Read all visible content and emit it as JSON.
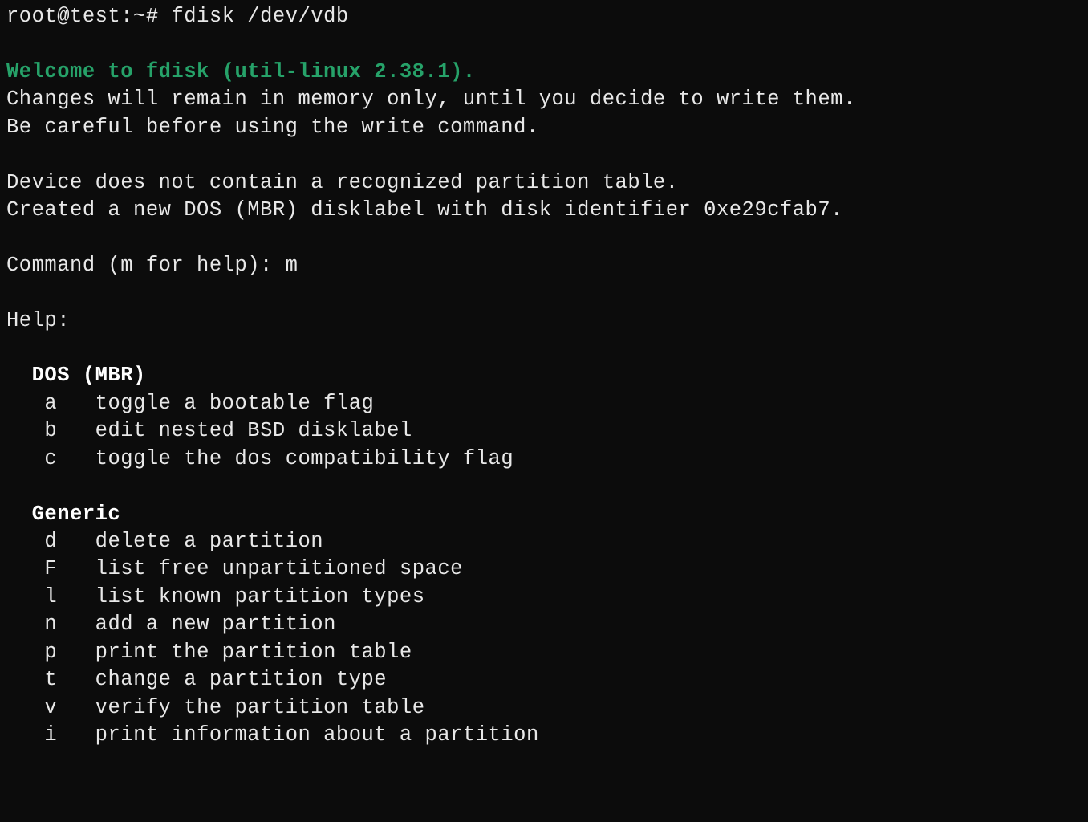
{
  "prompt": {
    "user_host": "root@test",
    "path": "~",
    "symbol": "#",
    "command": "fdisk /dev/vdb"
  },
  "welcome": "Welcome to fdisk (util-linux 2.38.1).",
  "warning_line1": "Changes will remain in memory only, until you decide to write them.",
  "warning_line2": "Be careful before using the write command.",
  "device_line1": "Device does not contain a recognized partition table.",
  "device_line2": "Created a new DOS (MBR) disklabel with disk identifier 0xe29cfab7.",
  "command_prompt": "Command (m for help): ",
  "command_input": "m",
  "help_header": "Help:",
  "sections": [
    {
      "title": "DOS (MBR)",
      "items": [
        {
          "key": "a",
          "desc": "toggle a bootable flag"
        },
        {
          "key": "b",
          "desc": "edit nested BSD disklabel"
        },
        {
          "key": "c",
          "desc": "toggle the dos compatibility flag"
        }
      ]
    },
    {
      "title": "Generic",
      "items": [
        {
          "key": "d",
          "desc": "delete a partition"
        },
        {
          "key": "F",
          "desc": "list free unpartitioned space"
        },
        {
          "key": "l",
          "desc": "list known partition types"
        },
        {
          "key": "n",
          "desc": "add a new partition"
        },
        {
          "key": "p",
          "desc": "print the partition table"
        },
        {
          "key": "t",
          "desc": "change a partition type"
        },
        {
          "key": "v",
          "desc": "verify the partition table"
        },
        {
          "key": "i",
          "desc": "print information about a partition"
        }
      ]
    }
  ]
}
